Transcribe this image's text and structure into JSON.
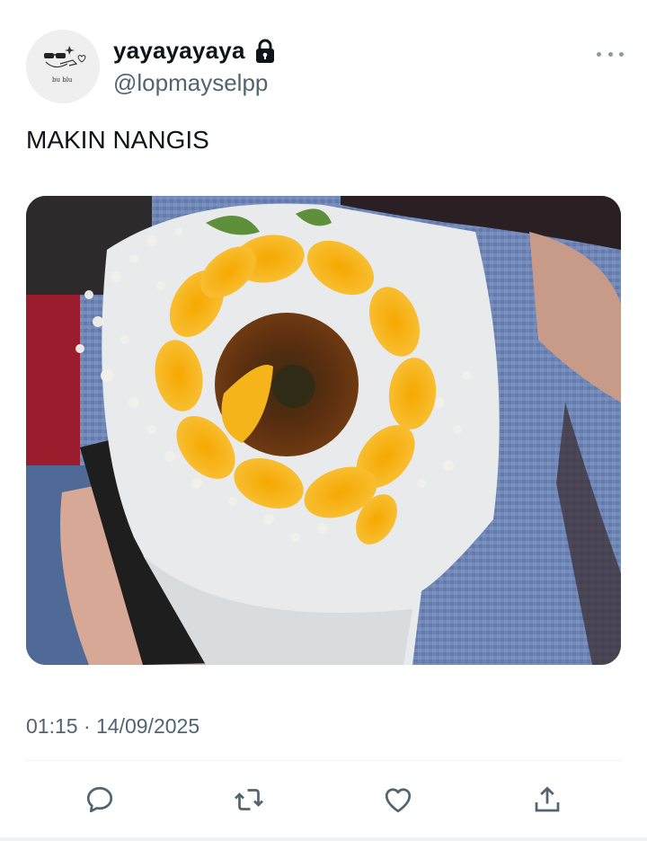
{
  "author": {
    "display_name": "yayayayaya",
    "handle": "@lopmayselpp",
    "avatar_caption": "bu blu"
  },
  "tweet": {
    "text": "MAKIN NANGIS",
    "timestamp": "01:15 · 14/09/2025"
  },
  "icons": {
    "more": "more-icon",
    "lock": "lock-icon",
    "reply": "reply-icon",
    "retweet": "retweet-icon",
    "like": "like-icon",
    "share": "share-icon"
  },
  "colors": {
    "text": "#0f1419",
    "secondary": "#536471",
    "divider": "#eff3f4"
  }
}
